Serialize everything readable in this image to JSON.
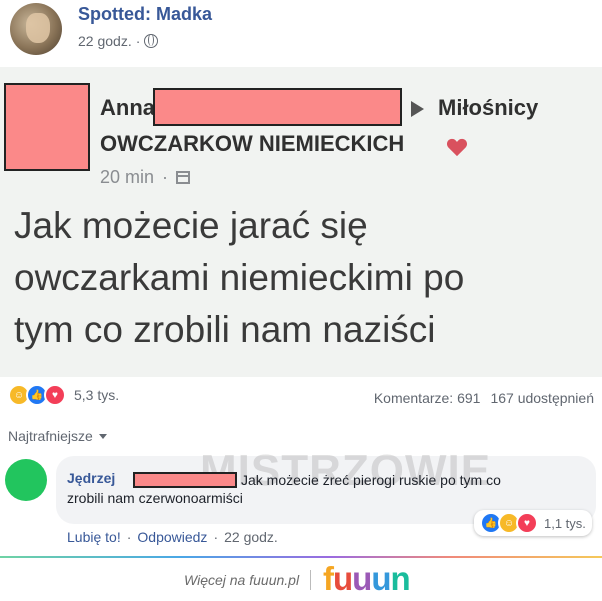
{
  "header": {
    "page_name": "Spotted: Madka",
    "time": "22 godz."
  },
  "screenshot": {
    "author_first": "Anna",
    "group_line1": "Miłośnicy",
    "group_line2": "OWCZARKOW NIEMIECKICH",
    "time": "20 min",
    "post_lines": [
      "Jak możecie jarać się",
      "owczarkami niemieckimi po",
      "tym co zrobili nam naziści"
    ]
  },
  "reactions": {
    "count": "5,3 tys.",
    "comments": "Komentarze: 691",
    "shares": "167 udostępnień"
  },
  "sort_label": "Najtrafniejsze",
  "comment": {
    "author": "Jędrzej",
    "text_line1": "Jak możecie żreć pierogi ruskie po tym co",
    "text_line2": "zrobili nam czerwonoarmiści",
    "reaction_count": "1,1 tys.",
    "like": "Lubię to!",
    "reply": "Odpowiedz",
    "time": "22 godz."
  },
  "watermark": "MISTRZOWIE",
  "footer": {
    "more_text": "Więcej na fuuun.pl",
    "logo_letters": [
      "f",
      "u",
      "u",
      "u",
      "n"
    ],
    "logo_colors": [
      "#f5a623",
      "#e74c3c",
      "#9b59b6",
      "#3498db",
      "#1abc9c"
    ]
  }
}
